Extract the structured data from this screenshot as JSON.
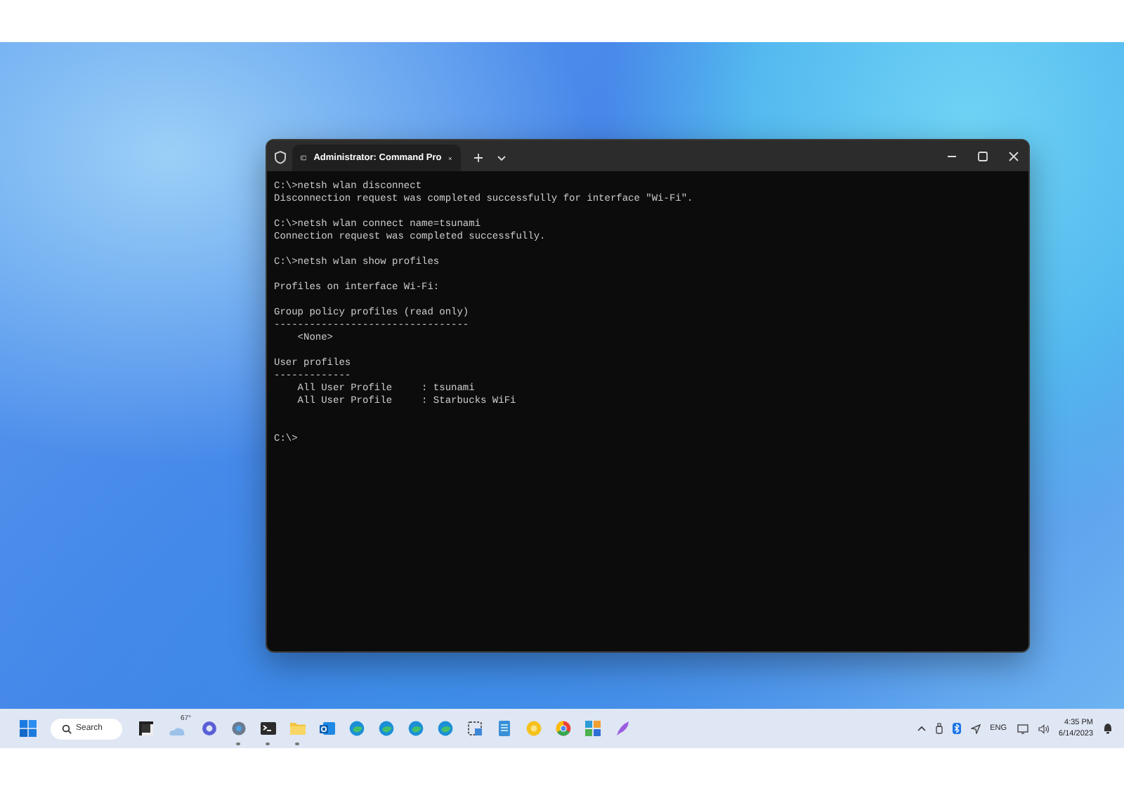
{
  "window": {
    "tab_title": "Administrator: Command Pro"
  },
  "terminal": {
    "blocks": [
      [
        "C:\\>netsh wlan disconnect",
        "Disconnection request was completed successfully for interface \"Wi-Fi\"."
      ],
      [
        "C:\\>netsh wlan connect name=tsunami",
        "Connection request was completed successfully."
      ],
      [
        "C:\\>netsh wlan show profiles"
      ],
      [
        "Profiles on interface Wi-Fi:"
      ],
      [
        "Group policy profiles (read only)",
        "---------------------------------",
        "    <None>"
      ],
      [
        "User profiles",
        "-------------",
        "    All User Profile     : tsunami",
        "    All User Profile     : Starbucks WiFi"
      ]
    ],
    "prompt": "C:\\>"
  },
  "taskbar": {
    "search_label": "Search",
    "weather_temp": "67°",
    "apps": [
      {
        "kind": "taskview",
        "running": false
      },
      {
        "kind": "weather",
        "running": false
      },
      {
        "kind": "chat",
        "running": false
      },
      {
        "kind": "settings",
        "running": true
      },
      {
        "kind": "terminal",
        "running": true
      },
      {
        "kind": "folder",
        "running": true
      },
      {
        "kind": "mail",
        "running": false
      },
      {
        "kind": "edge",
        "running": false
      },
      {
        "kind": "edge",
        "running": false
      },
      {
        "kind": "edge",
        "running": false
      },
      {
        "kind": "edge",
        "running": false
      },
      {
        "kind": "snip",
        "running": false
      },
      {
        "kind": "notepad",
        "running": false
      },
      {
        "kind": "yellow",
        "running": false
      },
      {
        "kind": "chrome",
        "running": false
      },
      {
        "kind": "tiles",
        "running": false
      },
      {
        "kind": "feather",
        "running": false
      }
    ],
    "language": "ENG",
    "time": "4:35 PM",
    "date": "6/14/2023"
  }
}
